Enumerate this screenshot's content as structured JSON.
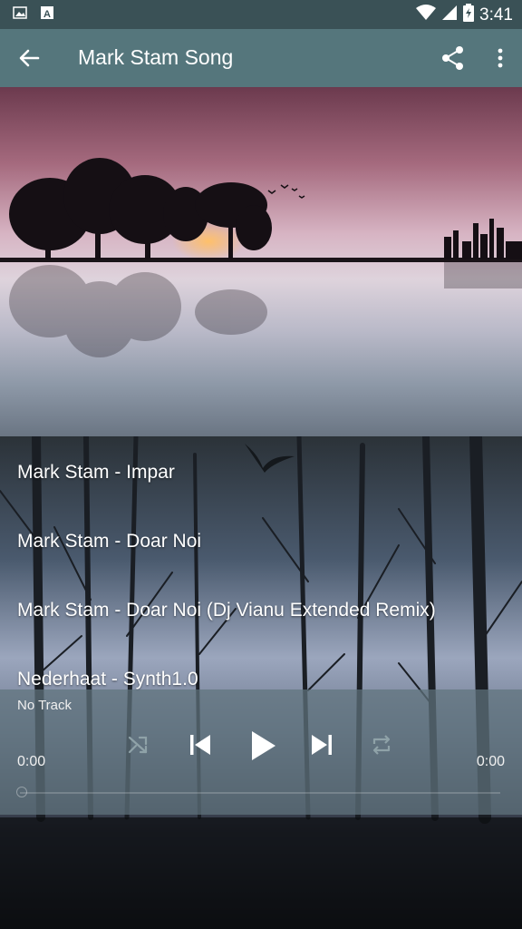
{
  "status_bar": {
    "time": "3:41",
    "icons": [
      "image-icon",
      "font-a-icon",
      "wifi-icon",
      "signal-icon",
      "battery-charging-icon"
    ]
  },
  "app_bar": {
    "title": "Mark Stam Song",
    "icons": [
      "back-arrow-icon",
      "share-icon",
      "more-vert-icon"
    ]
  },
  "songs": [
    {
      "title": "Mark Stam - Impar"
    },
    {
      "title": "Mark Stam - Doar Noi"
    },
    {
      "title": "Mark Stam - Doar Noi (Dj Vianu Extended Remix)"
    },
    {
      "title": "Nederhaat - Synth1.0"
    }
  ],
  "player": {
    "track_name": "No Track",
    "current_time": "0:00",
    "total_time": "0:00",
    "progress": 0,
    "controls": [
      "shuffle-icon",
      "skip-previous-icon",
      "play-icon",
      "skip-next-icon",
      "repeat-icon"
    ]
  },
  "colors": {
    "status_bar": "#3a5156",
    "app_bar": "#55767c",
    "player_bg": "#5f737d"
  }
}
